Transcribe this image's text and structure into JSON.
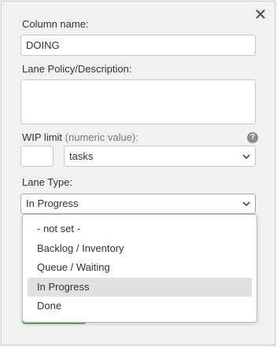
{
  "form": {
    "column_name_label": "Column name:",
    "column_name_value": "DOING",
    "lane_policy_label": "Lane Policy/Description:",
    "lane_policy_value": "",
    "wip_label": "WIP limit",
    "wip_hint": "(numeric value):",
    "wip_value": "",
    "wip_unit": "tasks",
    "help_glyph": "?",
    "lane_type_label": "Lane Type:",
    "lane_type_value": "In Progress"
  },
  "lane_type_options": [
    {
      "label": "- not set -",
      "selected": false
    },
    {
      "label": "Backlog / Inventory",
      "selected": false
    },
    {
      "label": "Queue / Waiting",
      "selected": false
    },
    {
      "label": "In Progress",
      "selected": true
    },
    {
      "label": "Done",
      "selected": false
    }
  ],
  "icons": {
    "close": "close-icon",
    "help": "help-icon",
    "chevron": "chevron-down-icon"
  },
  "colors": {
    "accent_green": "#5cb85c",
    "selected_option_bg": "#e1e1e1",
    "panel_bg": "#f2f2f2"
  }
}
